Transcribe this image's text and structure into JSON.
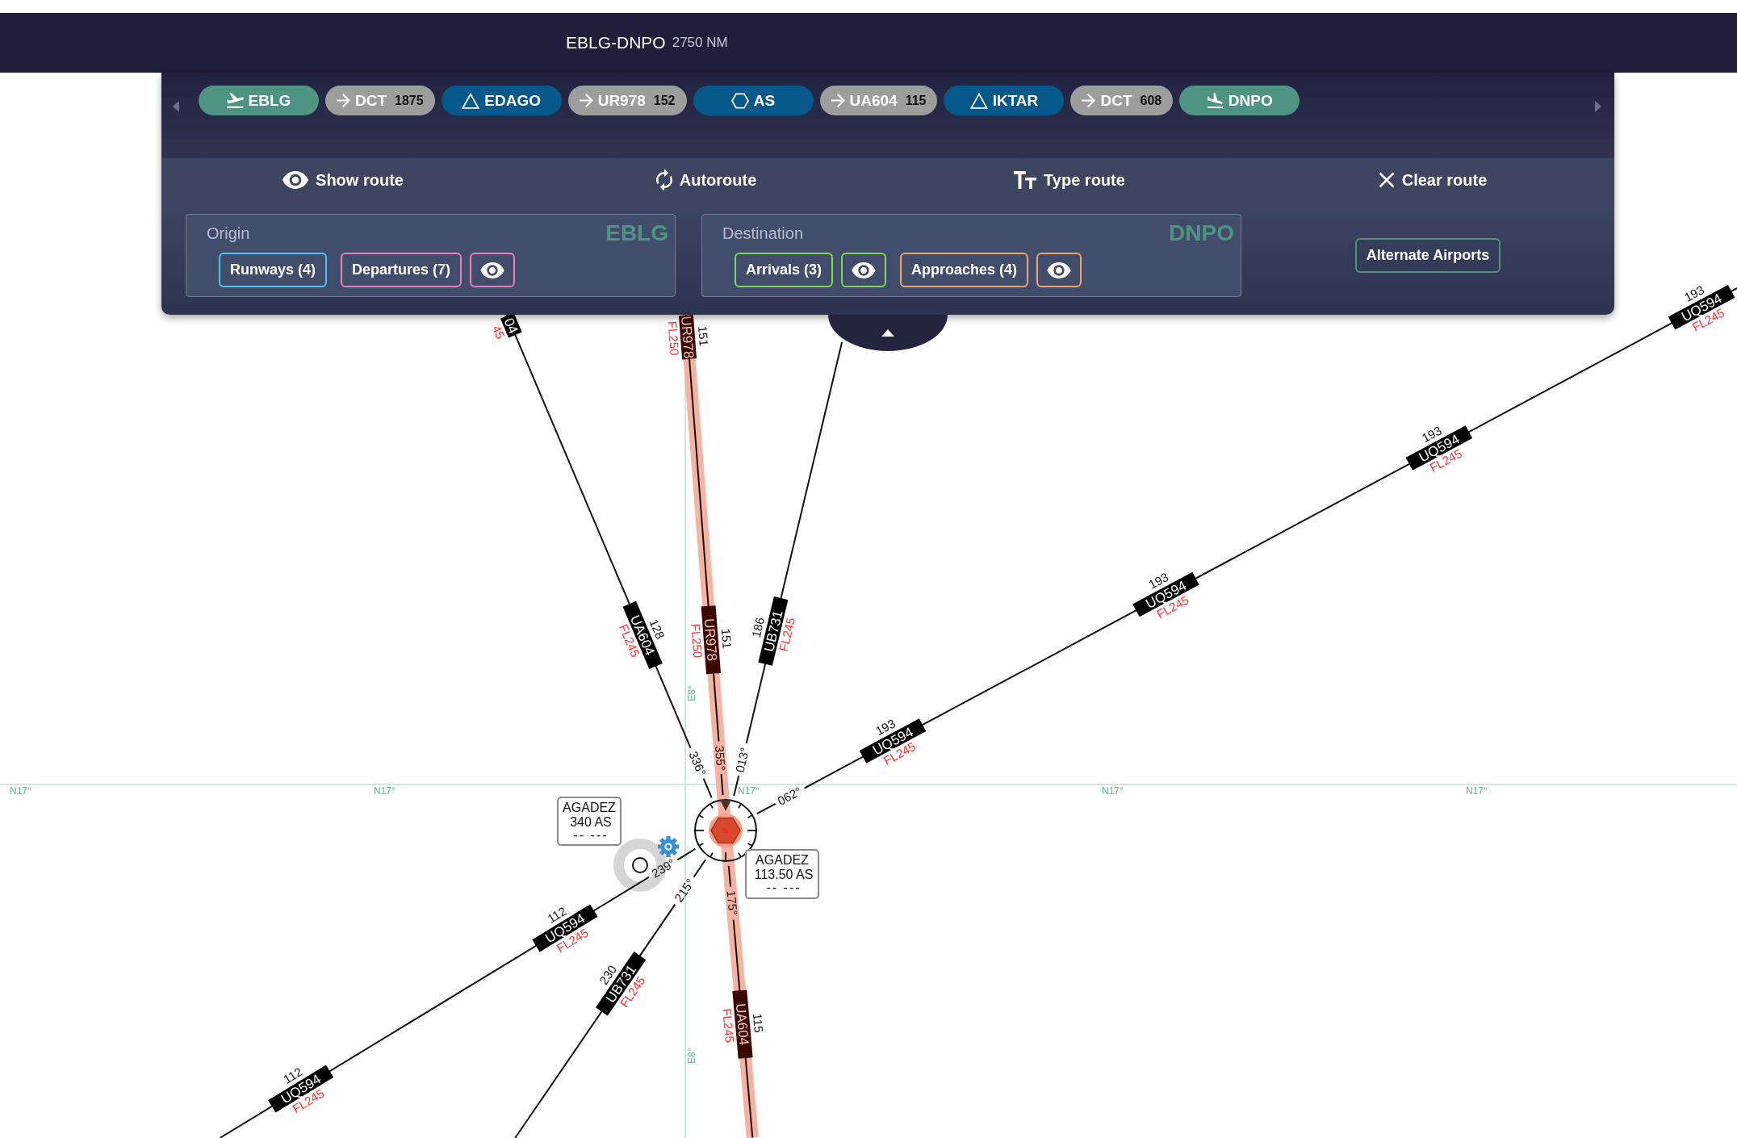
{
  "header": {
    "title": "EBLG-DNPO",
    "distance": "2750 NM"
  },
  "route": [
    {
      "kind": "departure",
      "label": "EBLG"
    },
    {
      "kind": "airway",
      "label": "DCT",
      "distance": "1875"
    },
    {
      "kind": "waypoint",
      "label": "EDAGO"
    },
    {
      "kind": "airway",
      "label": "UR978",
      "distance": "152"
    },
    {
      "kind": "navaid",
      "label": "AS"
    },
    {
      "kind": "airway",
      "label": "UA604",
      "distance": "115"
    },
    {
      "kind": "waypoint",
      "label": "IKTAR"
    },
    {
      "kind": "airway",
      "label": "DCT",
      "distance": "608"
    },
    {
      "kind": "arrival",
      "label": "DNPO"
    }
  ],
  "actions": [
    {
      "kind": "show",
      "label": "Show route"
    },
    {
      "kind": "autoroute",
      "label": "Autoroute"
    },
    {
      "kind": "type",
      "label": "Type route"
    },
    {
      "kind": "clear",
      "label": "Clear route"
    }
  ],
  "origin": {
    "title": "Origin",
    "code": "EBLG",
    "buttons": [
      {
        "kind": "text",
        "label": "Runways (4)",
        "color": "#4fc3f7"
      },
      {
        "kind": "text",
        "label": "Departures (7)",
        "color": "#e87fb8"
      },
      {
        "kind": "eye",
        "color": "#e87fb8"
      }
    ]
  },
  "destination": {
    "title": "Destination",
    "code": "DNPO",
    "buttons": [
      {
        "kind": "text",
        "label": "Arrivals (3)",
        "color": "#7ed957"
      },
      {
        "kind": "eye",
        "color": "#7ed957"
      },
      {
        "kind": "text",
        "label": "Approaches (4)",
        "color": "#eea46a"
      },
      {
        "kind": "eye",
        "color": "#eea46a"
      }
    ]
  },
  "alternate_button": "Alternate Airports",
  "map": {
    "grid": {
      "latitude_labels": [
        "N17°",
        "N17°",
        "N17°",
        "N17°",
        "N17°"
      ],
      "longitude_labels": [
        "E8°",
        "E8°"
      ]
    },
    "airways": [
      {
        "radial": "336°",
        "on_route": false,
        "labels": [
          {
            "distance": "128",
            "ident": "UA604",
            "flight_level": "FL245"
          },
          {
            "ident": "04",
            "flight_level": "45"
          }
        ]
      },
      {
        "radial": "355°",
        "on_route": true,
        "labels": [
          {
            "distance": "151",
            "ident": "UR978",
            "flight_level": "FL250"
          },
          {
            "distance": "151",
            "ident": "UR978",
            "flight_level": "FL250"
          }
        ]
      },
      {
        "radial": "013°",
        "on_route": false,
        "labels": [
          {
            "distance": "186",
            "ident": "UB731",
            "flight_level": "FL245"
          }
        ]
      },
      {
        "radial": "062°",
        "on_route": false,
        "labels": [
          {
            "distance": "193",
            "ident": "UQ594",
            "flight_level": "FL245"
          },
          {
            "distance": "193",
            "ident": "UQ594",
            "flight_level": "FL245"
          },
          {
            "distance": "193",
            "ident": "UQ594",
            "flight_level": "FL245"
          },
          {
            "distance": "193",
            "ident": "UQ594",
            "flight_level": "FL245"
          }
        ]
      },
      {
        "radial": "239°",
        "on_route": false,
        "labels": [
          {
            "distance": "112",
            "ident": "UQ594",
            "flight_level": "FL245"
          },
          {
            "distance": "112",
            "ident": "UQ594",
            "flight_level": "FL245"
          }
        ]
      },
      {
        "radial": "215°",
        "on_route": false,
        "labels": [
          {
            "distance": "230",
            "ident": "UB731",
            "flight_level": "FL245"
          }
        ]
      },
      {
        "radial": "175°",
        "on_route": true,
        "labels": [
          {
            "distance": "115",
            "ident": "UA604",
            "flight_level": "FL245"
          }
        ]
      }
    ],
    "ndb": {
      "name": "AGADEZ",
      "frequency": "340 AS",
      "morse": "-- ---"
    },
    "vor": {
      "name": "AGADEZ",
      "frequency": "113.50 AS",
      "morse": "-- ---"
    }
  }
}
